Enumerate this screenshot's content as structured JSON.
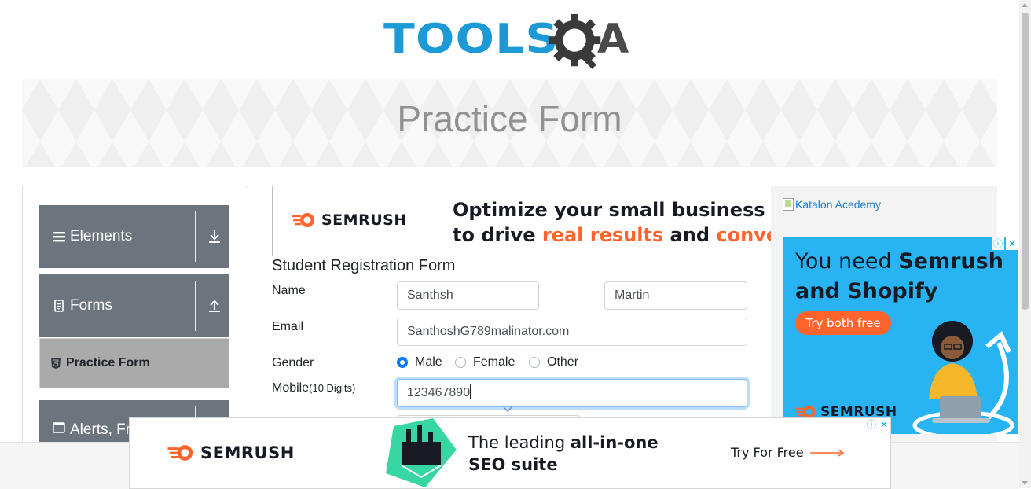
{
  "header": {
    "logo_tools": "TOOLS",
    "logo_qa": "A"
  },
  "banner": {
    "title": "Practice Form"
  },
  "sidebar": {
    "groups": [
      {
        "label": "Elements",
        "icon": "hamburger-icon",
        "toggle": "download-arrow-icon"
      },
      {
        "label": "Forms",
        "icon": "document-icon",
        "toggle": "upload-arrow-icon"
      },
      {
        "label": "Alerts, Fr",
        "icon": "window-icon"
      }
    ],
    "active_item": {
      "label": "Practice Form",
      "icon": "html5-icon"
    }
  },
  "ads": {
    "top": {
      "brand": "SEMRUSH",
      "line1": "Optimize your small business wel",
      "line2_a": "to drive ",
      "line2_b": "real results",
      "line2_c": " and ",
      "line2_d": "conversi",
      "accent": "#ff642d"
    },
    "right_link": "Katalon Acedemy",
    "right": {
      "line1_a": "You need ",
      "line1_b": "Semrush",
      "line2": "and Shopify",
      "cta": "Try both free",
      "brand": "SEMRUSH",
      "bg": "#28b4f3"
    },
    "bottom": {
      "brand": "SEMRUSH",
      "line1_a": "The leading ",
      "line1_b": "all-in-one",
      "line2": "SEO suite",
      "cta": "Try For Free"
    }
  },
  "form": {
    "title": "Student Registration Form",
    "name_label": "Name",
    "first_name": "Santhsh",
    "last_name": "Martin",
    "email_label": "Email",
    "email": "SanthoshG789malinator.com",
    "gender_label": "Gender",
    "gender_options": [
      "Male",
      "Female",
      "Other"
    ],
    "gender_selected": "Male",
    "mobile_label": "Mobile",
    "mobile_hint": "(10 Digits)",
    "mobile": "123467890"
  }
}
